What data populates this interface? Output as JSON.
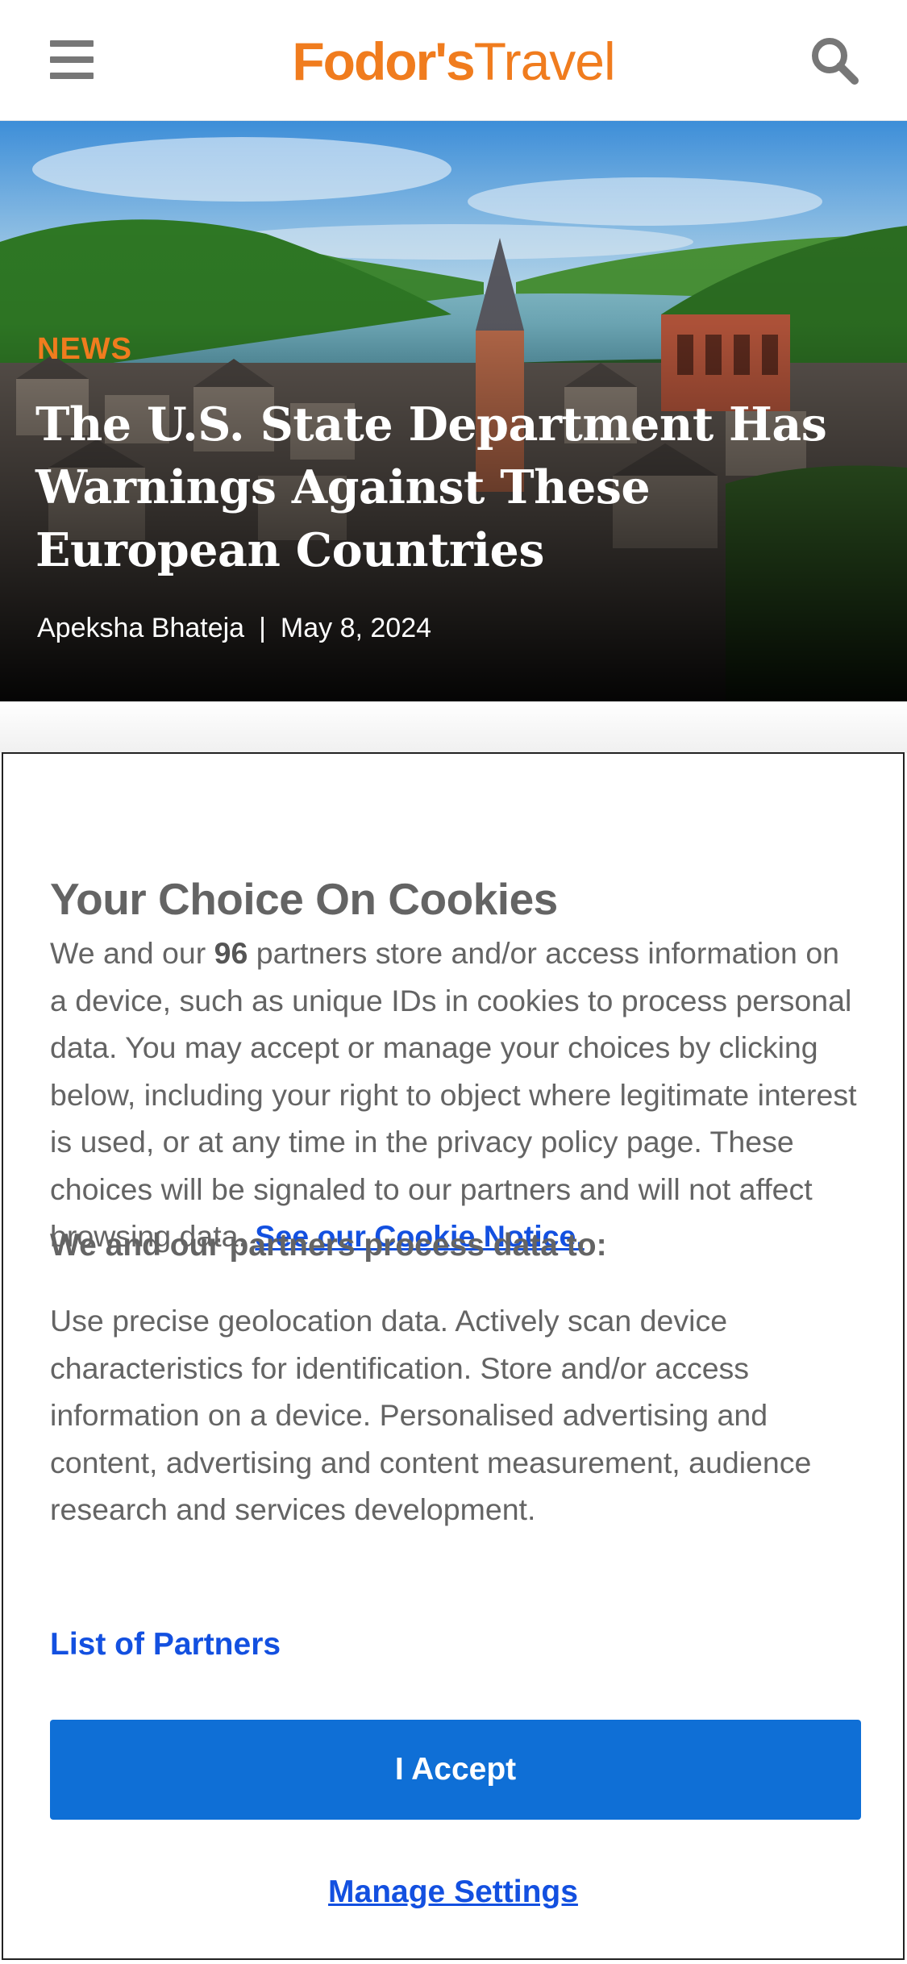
{
  "header": {
    "logo_bold": "Fodor's",
    "logo_light": "Travel",
    "menu_icon": "hamburger-menu-icon",
    "search_icon": "search-icon",
    "brand_color": "#f07c1e"
  },
  "article": {
    "category": "NEWS",
    "headline": "The U.S. State Department Has Warnings Against These European Countries",
    "author": "Apeksha Bhateja",
    "separator": "|",
    "date": "May 8, 2024"
  },
  "cookie_dialog": {
    "title": "Your Choice On Cookies",
    "body_prefix": "We and our ",
    "partner_count": "96",
    "body_text": " partners store and/or access information on a device, such as unique IDs in cookies to process personal data. You may accept or manage your choices by clicking below, including your right to object where legitimate interest is used, or at any time in the privacy policy page. These choices will be signaled to our partners and will not affect browsing data. ",
    "notice_link": "See our Cookie Notice.",
    "purposes_title": "We and our partners process data to:",
    "purposes_text": "Use precise geolocation data. Actively scan device characteristics for identification. Store and/or access information on a device. Personalised advertising and content, advertising and content measurement, audience research and services development.",
    "partners_link": "List of Partners",
    "accept_label": "I Accept",
    "manage_label": "Manage Settings",
    "link_color": "#1350e0",
    "button_color": "#0f6fd6"
  }
}
